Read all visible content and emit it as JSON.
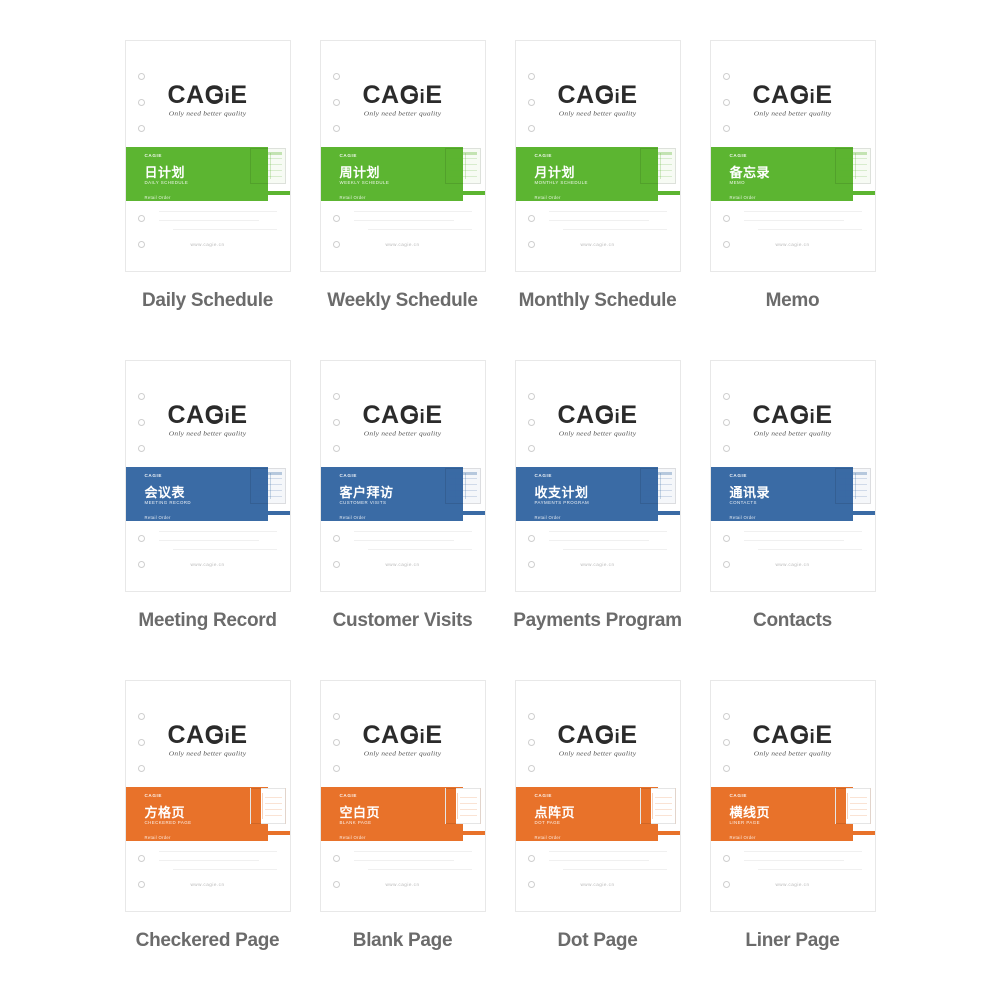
{
  "brand": {
    "wordmark_pre": "CA",
    "wordmark_g": "G",
    "wordmark_i": "i",
    "wordmark_post": "E",
    "tagline": "Only need better quality",
    "website": "www.cagie.cn"
  },
  "palette": {
    "green": "#5cb531",
    "blue": "#3a6ba5",
    "orange": "#e8722a",
    "caption": "#6b6b6b",
    "sheet_border": "#e8e8e8",
    "hole_border": "#cfcfcf"
  },
  "products": [
    {
      "caption": "Daily Schedule",
      "band_brand": "CAGIE",
      "band_cn": "日计划",
      "band_en": "DAILY SCHEDULE",
      "band_note": "Retail Order",
      "color": "#5cb531",
      "thumb_kind": "form-grid"
    },
    {
      "caption": "Weekly Schedule",
      "band_brand": "CAGIE",
      "band_cn": "周计划",
      "band_en": "WEEKLY SCHEDULE",
      "band_note": "Retail Order",
      "color": "#5cb531",
      "thumb_kind": "form-grid"
    },
    {
      "caption": "Monthly Schedule",
      "band_brand": "CAGIE",
      "band_cn": "月计划",
      "band_en": "MONTHLY SCHEDULE",
      "band_note": "Retail Order",
      "color": "#5cb531",
      "thumb_kind": "form-grid"
    },
    {
      "caption": "Memo",
      "band_brand": "CAGIE",
      "band_cn": "备忘录",
      "band_en": "MEMO",
      "band_note": "Retail Order",
      "color": "#5cb531",
      "thumb_kind": "form-grid"
    },
    {
      "caption": "Meeting Record",
      "band_brand": "CAGIE",
      "band_cn": "会议表",
      "band_en": "MEETING RECORD",
      "band_note": "Retail Order",
      "color": "#3a6ba5",
      "thumb_kind": "form-grid"
    },
    {
      "caption": "Customer Visits",
      "band_brand": "CAGIE",
      "band_cn": "客户拜访",
      "band_en": "CUSTOMER VISITS",
      "band_note": "Retail Order",
      "color": "#3a6ba5",
      "thumb_kind": "form-grid"
    },
    {
      "caption": "Payments Program",
      "band_brand": "CAGIE",
      "band_cn": "收支计划",
      "band_en": "PAYMENTS PROGRAM",
      "band_note": "Retail Order",
      "color": "#3a6ba5",
      "thumb_kind": "form-grid"
    },
    {
      "caption": "Contacts",
      "band_brand": "CAGIE",
      "band_cn": "通讯录",
      "band_en": "CONTACTS",
      "band_note": "Retail Order",
      "color": "#3a6ba5",
      "thumb_kind": "form-grid"
    },
    {
      "caption": "Checkered Page",
      "band_brand": "CAGIE",
      "band_cn": "方格页",
      "band_en": "CHECKERED PAGE",
      "band_note": "Retail Order",
      "color": "#e8722a",
      "thumb_kind": "book"
    },
    {
      "caption": "Blank Page",
      "band_brand": "CAGIE",
      "band_cn": "空白页",
      "band_en": "BLANK PAGE",
      "band_note": "Retail Order",
      "color": "#e8722a",
      "thumb_kind": "book"
    },
    {
      "caption": "Dot Page",
      "band_brand": "CAGIE",
      "band_cn": "点阵页",
      "band_en": "DOT PAGE",
      "band_note": "Retail Order",
      "color": "#e8722a",
      "thumb_kind": "book"
    },
    {
      "caption": "Liner Page",
      "band_brand": "CAGIE",
      "band_cn": "横线页",
      "band_en": "LINER PAGE",
      "band_note": "Retail Order",
      "color": "#e8722a",
      "thumb_kind": "book"
    }
  ]
}
